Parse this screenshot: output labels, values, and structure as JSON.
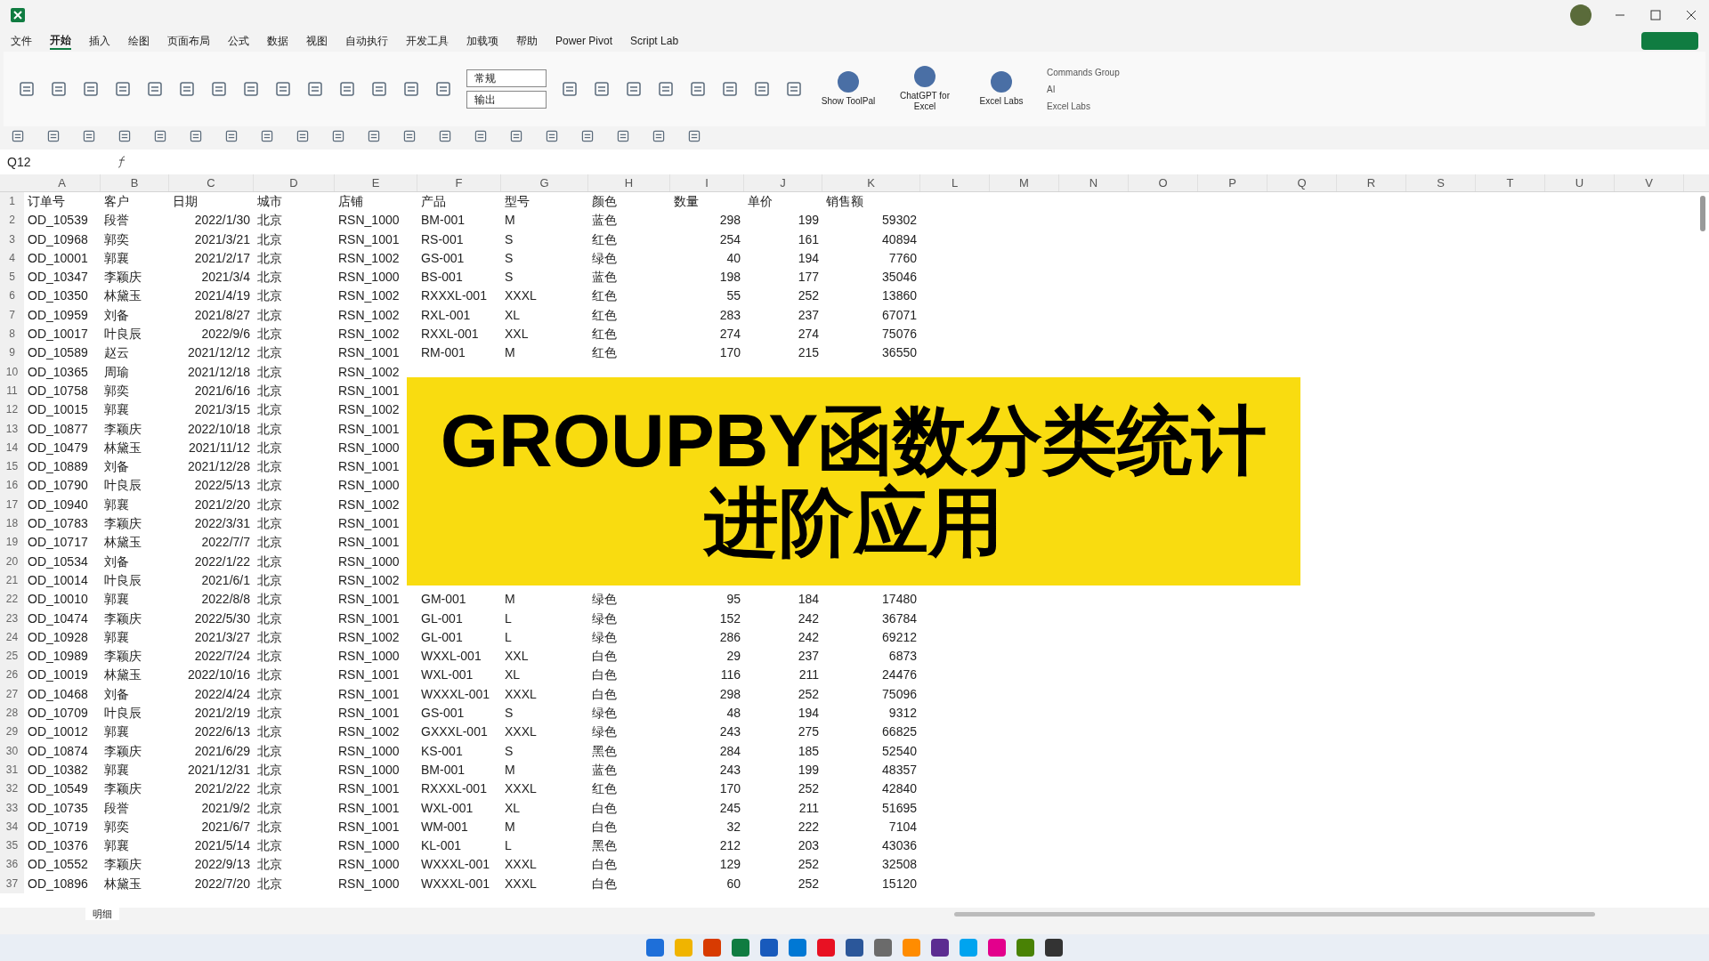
{
  "menu_tabs": [
    {
      "label": "文件",
      "selected": false
    },
    {
      "label": "开始",
      "selected": true
    },
    {
      "label": "插入",
      "selected": false
    },
    {
      "label": "绘图",
      "selected": false
    },
    {
      "label": "页面布局",
      "selected": false
    },
    {
      "label": "公式",
      "selected": false
    },
    {
      "label": "数据",
      "selected": false
    },
    {
      "label": "视图",
      "selected": false
    },
    {
      "label": "自动执行",
      "selected": false
    },
    {
      "label": "开发工具",
      "selected": false
    },
    {
      "label": "加载项",
      "selected": false
    },
    {
      "label": "帮助",
      "selected": false
    },
    {
      "label": "Power Pivot",
      "selected": false
    },
    {
      "label": "Script Lab",
      "selected": false
    }
  ],
  "ribbon": {
    "styles": [
      "常规",
      "输出"
    ],
    "addins": [
      {
        "label": "Show ToolPal"
      },
      {
        "label": "ChatGPT for Excel"
      },
      {
        "label": "Excel Labs"
      }
    ],
    "group_labels": [
      "Commands Group",
      "AI",
      "Excel Labs"
    ]
  },
  "name_box": "Q12",
  "column_letters": [
    "A",
    "B",
    "C",
    "D",
    "E",
    "F",
    "G",
    "H",
    "I",
    "J",
    "K",
    "L",
    "M",
    "N",
    "O",
    "P",
    "Q",
    "R",
    "S",
    "T",
    "U",
    "V"
  ],
  "rows": [
    {
      "n": "1",
      "cells": [
        "订单号",
        "客户",
        "日期",
        "城市",
        "店铺",
        "产品",
        "型号",
        "颜色",
        "数量",
        "单价",
        "销售额"
      ]
    },
    {
      "n": "2",
      "cells": [
        "OD_10539",
        "段誉",
        "2022/1/30",
        "北京",
        "RSN_1000",
        "BM-001",
        "M",
        "蓝色",
        "298",
        "199",
        "59302"
      ]
    },
    {
      "n": "3",
      "cells": [
        "OD_10968",
        "郭奕",
        "2021/3/21",
        "北京",
        "RSN_1001",
        "RS-001",
        "S",
        "红色",
        "254",
        "161",
        "40894"
      ]
    },
    {
      "n": "4",
      "cells": [
        "OD_10001",
        "郭襄",
        "2021/2/17",
        "北京",
        "RSN_1002",
        "GS-001",
        "S",
        "绿色",
        "40",
        "194",
        "7760"
      ]
    },
    {
      "n": "5",
      "cells": [
        "OD_10347",
        "李颖庆",
        "2021/3/4",
        "北京",
        "RSN_1000",
        "BS-001",
        "S",
        "蓝色",
        "198",
        "177",
        "35046"
      ]
    },
    {
      "n": "6",
      "cells": [
        "OD_10350",
        "林黛玉",
        "2021/4/19",
        "北京",
        "RSN_1002",
        "RXXXL-001",
        "XXXL",
        "红色",
        "55",
        "252",
        "13860"
      ]
    },
    {
      "n": "7",
      "cells": [
        "OD_10959",
        "刘备",
        "2021/8/27",
        "北京",
        "RSN_1002",
        "RXL-001",
        "XL",
        "红色",
        "283",
        "237",
        "67071"
      ]
    },
    {
      "n": "8",
      "cells": [
        "OD_10017",
        "叶良辰",
        "2022/9/6",
        "北京",
        "RSN_1002",
        "RXXL-001",
        "XXL",
        "红色",
        "274",
        "274",
        "75076"
      ]
    },
    {
      "n": "9",
      "cells": [
        "OD_10589",
        "赵云",
        "2021/12/12",
        "北京",
        "RSN_1001",
        "RM-001",
        "M",
        "红色",
        "170",
        "215",
        "36550"
      ]
    },
    {
      "n": "10",
      "cells": [
        "OD_10365",
        "周瑜",
        "2021/12/18",
        "北京",
        "RSN_1002"
      ]
    },
    {
      "n": "11",
      "cells": [
        "OD_10758",
        "郭奕",
        "2021/6/16",
        "北京",
        "RSN_1001"
      ]
    },
    {
      "n": "12",
      "cells": [
        "OD_10015",
        "郭襄",
        "2021/3/15",
        "北京",
        "RSN_1002"
      ]
    },
    {
      "n": "13",
      "cells": [
        "OD_10877",
        "李颖庆",
        "2022/10/18",
        "北京",
        "RSN_1001"
      ]
    },
    {
      "n": "14",
      "cells": [
        "OD_10479",
        "林黛玉",
        "2021/11/12",
        "北京",
        "RSN_1000"
      ]
    },
    {
      "n": "15",
      "cells": [
        "OD_10889",
        "刘备",
        "2021/12/28",
        "北京",
        "RSN_1001"
      ]
    },
    {
      "n": "16",
      "cells": [
        "OD_10790",
        "叶良辰",
        "2022/5/13",
        "北京",
        "RSN_1000"
      ]
    },
    {
      "n": "17",
      "cells": [
        "OD_10940",
        "郭襄",
        "2021/2/20",
        "北京",
        "RSN_1002"
      ]
    },
    {
      "n": "18",
      "cells": [
        "OD_10783",
        "李颖庆",
        "2022/3/31",
        "北京",
        "RSN_1001"
      ]
    },
    {
      "n": "19",
      "cells": [
        "OD_10717",
        "林黛玉",
        "2022/7/7",
        "北京",
        "RSN_1001"
      ]
    },
    {
      "n": "20",
      "cells": [
        "OD_10534",
        "刘备",
        "2022/1/22",
        "北京",
        "RSN_1000"
      ]
    },
    {
      "n": "21",
      "cells": [
        "OD_10014",
        "叶良辰",
        "2021/6/1",
        "北京",
        "RSN_1002"
      ]
    },
    {
      "n": "22",
      "cells": [
        "OD_10010",
        "郭襄",
        "2022/8/8",
        "北京",
        "RSN_1001",
        "GM-001",
        "M",
        "绿色",
        "95",
        "184",
        "17480"
      ]
    },
    {
      "n": "23",
      "cells": [
        "OD_10474",
        "李颖庆",
        "2022/5/30",
        "北京",
        "RSN_1001",
        "GL-001",
        "L",
        "绿色",
        "152",
        "242",
        "36784"
      ]
    },
    {
      "n": "24",
      "cells": [
        "OD_10928",
        "郭襄",
        "2021/3/27",
        "北京",
        "RSN_1002",
        "GL-001",
        "L",
        "绿色",
        "286",
        "242",
        "69212"
      ]
    },
    {
      "n": "25",
      "cells": [
        "OD_10989",
        "李颖庆",
        "2022/7/24",
        "北京",
        "RSN_1000",
        "WXXL-001",
        "XXL",
        "白色",
        "29",
        "237",
        "6873"
      ]
    },
    {
      "n": "26",
      "cells": [
        "OD_10019",
        "林黛玉",
        "2022/10/16",
        "北京",
        "RSN_1001",
        "WXL-001",
        "XL",
        "白色",
        "116",
        "211",
        "24476"
      ]
    },
    {
      "n": "27",
      "cells": [
        "OD_10468",
        "刘备",
        "2022/4/24",
        "北京",
        "RSN_1001",
        "WXXXL-001",
        "XXXL",
        "白色",
        "298",
        "252",
        "75096"
      ]
    },
    {
      "n": "28",
      "cells": [
        "OD_10709",
        "叶良辰",
        "2021/2/19",
        "北京",
        "RSN_1001",
        "GS-001",
        "S",
        "绿色",
        "48",
        "194",
        "9312"
      ]
    },
    {
      "n": "29",
      "cells": [
        "OD_10012",
        "郭襄",
        "2022/6/13",
        "北京",
        "RSN_1002",
        "GXXXL-001",
        "XXXL",
        "绿色",
        "243",
        "275",
        "66825"
      ]
    },
    {
      "n": "30",
      "cells": [
        "OD_10874",
        "李颖庆",
        "2021/6/29",
        "北京",
        "RSN_1000",
        "KS-001",
        "S",
        "黑色",
        "284",
        "185",
        "52540"
      ]
    },
    {
      "n": "31",
      "cells": [
        "OD_10382",
        "郭襄",
        "2021/12/31",
        "北京",
        "RSN_1000",
        "BM-001",
        "M",
        "蓝色",
        "243",
        "199",
        "48357"
      ]
    },
    {
      "n": "32",
      "cells": [
        "OD_10549",
        "李颖庆",
        "2021/2/22",
        "北京",
        "RSN_1001",
        "RXXXL-001",
        "XXXL",
        "红色",
        "170",
        "252",
        "42840"
      ]
    },
    {
      "n": "33",
      "cells": [
        "OD_10735",
        "段誉",
        "2021/9/2",
        "北京",
        "RSN_1001",
        "WXL-001",
        "XL",
        "白色",
        "245",
        "211",
        "51695"
      ]
    },
    {
      "n": "34",
      "cells": [
        "OD_10719",
        "郭奕",
        "2021/6/7",
        "北京",
        "RSN_1001",
        "WM-001",
        "M",
        "白色",
        "32",
        "222",
        "7104"
      ]
    },
    {
      "n": "35",
      "cells": [
        "OD_10376",
        "郭襄",
        "2021/5/14",
        "北京",
        "RSN_1000",
        "KL-001",
        "L",
        "黑色",
        "212",
        "203",
        "43036"
      ]
    },
    {
      "n": "36",
      "cells": [
        "OD_10552",
        "李颖庆",
        "2022/9/13",
        "北京",
        "RSN_1000",
        "WXXXL-001",
        "XXXL",
        "白色",
        "129",
        "252",
        "32508"
      ]
    },
    {
      "n": "37",
      "cells": [
        "OD_10896",
        "林黛玉",
        "2022/7/20",
        "北京",
        "RSN_1000",
        "WXXXL-001",
        "XXXL",
        "白色",
        "60",
        "252",
        "15120"
      ]
    }
  ],
  "overlay": {
    "lines": [
      "GROUPBY函数分类统计",
      "进阶应用"
    ]
  },
  "sheet_tab": "明细",
  "taskbar_apps": [
    {
      "color": "#1e6fd9"
    },
    {
      "color": "#f0b400"
    },
    {
      "color": "#d83b01"
    },
    {
      "color": "#107c41"
    },
    {
      "color": "#185abc"
    },
    {
      "color": "#0078d4"
    },
    {
      "color": "#e81123"
    },
    {
      "color": "#2b579a"
    },
    {
      "color": "#6b6b6b"
    },
    {
      "color": "#ff8c00"
    },
    {
      "color": "#5c2d91"
    },
    {
      "color": "#00a4ef"
    },
    {
      "color": "#e3008c"
    },
    {
      "color": "#498205"
    },
    {
      "color": "#333333"
    }
  ]
}
